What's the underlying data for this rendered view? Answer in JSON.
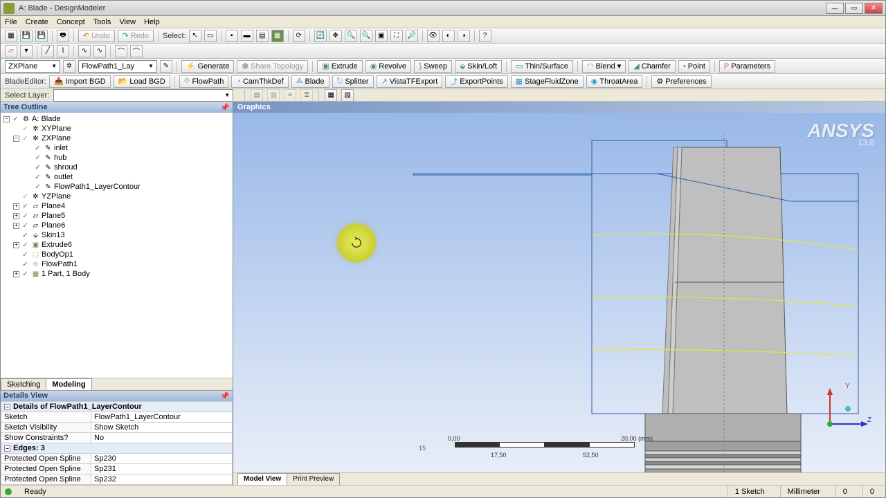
{
  "window": {
    "title": "A: Blade - DesignModeler"
  },
  "menu": [
    "File",
    "Create",
    "Concept",
    "Tools",
    "View",
    "Help"
  ],
  "toolbar1": {
    "undo": "Undo",
    "redo": "Redo",
    "select": "Select:"
  },
  "toolbar3": {
    "plane_combo": "ZXPlane",
    "sketch_combo": "FlowPath1_Lay",
    "generate": "Generate",
    "share_topo": "Share Topology",
    "extrude": "Extrude",
    "revolve": "Revolve",
    "sweep": "Sweep",
    "skin": "Skin/Loft",
    "thin": "Thin/Surface",
    "blend": "Blend",
    "chamfer": "Chamfer",
    "point": "Point",
    "parameters": "Parameters"
  },
  "toolbar4": {
    "label": "BladeEditor:",
    "import": "Import BGD",
    "load": "Load BGD",
    "flowpath": "FlowPath",
    "camthk": "CamThkDef",
    "blade": "Blade",
    "splitter": "Splitter",
    "vista": "VistaTFExport",
    "export": "ExportPoints",
    "stage": "StageFluidZone",
    "throat": "ThroatArea",
    "prefs": "Preferences"
  },
  "layerrow": {
    "label": "Select Layer:"
  },
  "tree": {
    "title": "Tree Outline",
    "root": "A: Blade",
    "items": [
      "XYPlane",
      "ZXPlane",
      "inlet",
      "hub",
      "shroud",
      "outlet",
      "FlowPath1_LayerContour",
      "YZPlane",
      "Plane4",
      "Plane5",
      "Plane6",
      "Skin13",
      "Extrude6",
      "BodyOp1",
      "FlowPath1",
      "1 Part, 1 Body"
    ]
  },
  "tabs": {
    "sketching": "Sketching",
    "modeling": "Modeling"
  },
  "details": {
    "title": "Details View",
    "group": "Details of FlowPath1_LayerContour",
    "rows": [
      [
        "Sketch",
        "FlowPath1_LayerContour"
      ],
      [
        "Sketch Visibility",
        "Show Sketch"
      ],
      [
        "Show Constraints?",
        "No"
      ]
    ],
    "edges_group": "Edges: 3",
    "edge_rows": [
      [
        "Protected Open Spline",
        "Sp230"
      ],
      [
        "Protected Open Spline",
        "Sp231"
      ],
      [
        "Protected Open Spline",
        "Sp232"
      ]
    ]
  },
  "graphics": {
    "title": "Graphics",
    "logo": "ANSYS",
    "version": "13.0",
    "scale": {
      "l0": "0,00",
      "l1": "15,00",
      "l2": "17,50",
      "l3": "20,00 (mm)",
      "l4": "52,50"
    },
    "axes": {
      "y": "Y",
      "z": "Z"
    },
    "tabs": {
      "model": "Model View",
      "print": "Print Preview"
    }
  },
  "status": {
    "ready": "Ready",
    "sel": "1 Sketch",
    "unit": "Millimeter",
    "n1": "0",
    "n2": "0"
  }
}
